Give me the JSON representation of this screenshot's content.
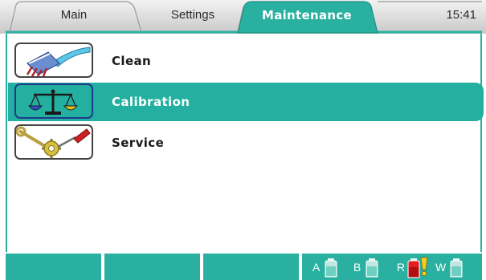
{
  "tabs": [
    {
      "label": "Main"
    },
    {
      "label": "Settings"
    },
    {
      "label": "Maintenance",
      "active": true
    }
  ],
  "clock": "15:41",
  "menu": [
    {
      "label": "Clean",
      "icon": "brush-icon",
      "selected": false
    },
    {
      "label": "Calibration",
      "icon": "scale-icon",
      "selected": true
    },
    {
      "label": "Service",
      "icon": "tools-icon",
      "selected": false
    }
  ],
  "bottles": [
    {
      "letter": "A",
      "state": "ok"
    },
    {
      "letter": "B",
      "state": "ok"
    },
    {
      "letter": "R",
      "state": "warning"
    },
    {
      "letter": "W",
      "state": "ok"
    }
  ],
  "colors": {
    "accent": "#29b0a0",
    "selected_row": "#23b0a0",
    "warning": "#e02020"
  }
}
